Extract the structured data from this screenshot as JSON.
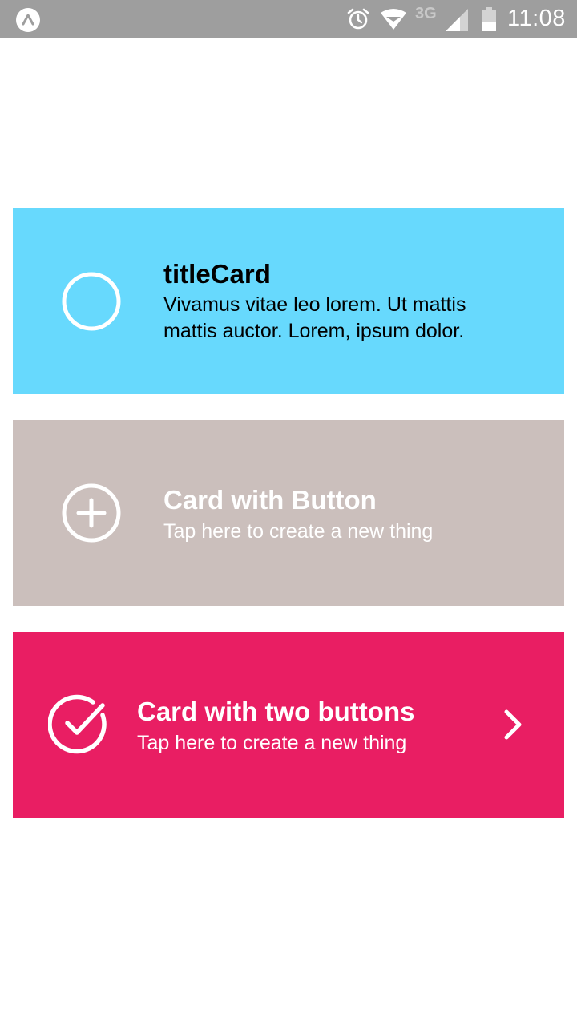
{
  "status_bar": {
    "network_label": "3G",
    "time": "11:08",
    "icons": [
      "app-logo-icon",
      "alarm-icon",
      "wifi-icon",
      "signal-icon",
      "battery-icon"
    ]
  },
  "cards": [
    {
      "title": "titleCard",
      "subtitle": "Vivamus vitae leo lorem. Ut mattis",
      "subtitle_line2": "mattis auctor. Lorem, ipsum dolor.",
      "icon": "circle-outline-icon",
      "background": "#67d9fd"
    },
    {
      "title": "Card with Button",
      "subtitle": "Tap here to create a new thing",
      "icon": "plus-circle-icon",
      "background": "#cbbfbc"
    },
    {
      "title": "Card with two buttons",
      "subtitle": "Tap here to create a new thing",
      "icon": "check-circle-icon",
      "action_icon": "chevron-right-icon",
      "background": "#e91e63"
    }
  ]
}
